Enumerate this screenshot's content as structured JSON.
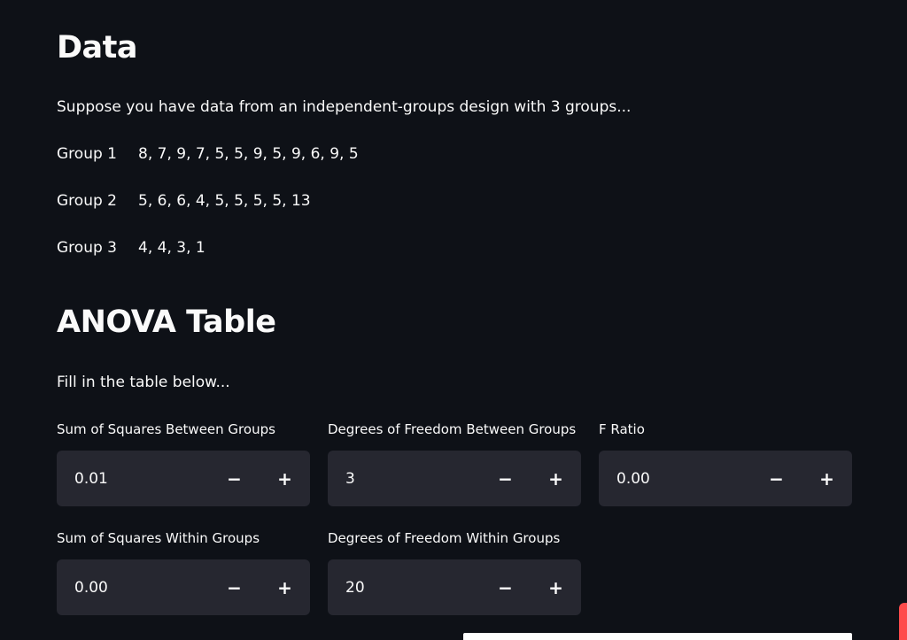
{
  "data_section": {
    "heading": "Data",
    "intro": "Suppose you have data from an independent-groups design with 3 groups...",
    "groups": [
      {
        "label": "Group 1",
        "values": "8, 7, 9, 7, 5, 5, 9, 5, 9, 6, 9, 5"
      },
      {
        "label": "Group 2",
        "values": "5, 6, 6, 4, 5, 5, 5, 5, 13"
      },
      {
        "label": "Group 3",
        "values": "4, 4, 3, 1"
      }
    ]
  },
  "anova_section": {
    "heading": "ANOVA Table",
    "instructions": "Fill in the table below...",
    "fields": {
      "ss_between": {
        "label": "Sum of Squares Between Groups",
        "value": "0.01"
      },
      "df_between": {
        "label": "Degrees of Freedom Between Groups",
        "value": "3"
      },
      "f_ratio": {
        "label": "F Ratio",
        "value": "0.00"
      },
      "ss_within": {
        "label": "Sum of Squares Within Groups",
        "value": "0.00"
      },
      "df_within": {
        "label": "Degrees of Freedom Within Groups",
        "value": "20"
      }
    },
    "decrement_symbol": "−",
    "increment_symbol": "+"
  },
  "colors": {
    "background": "#0e1117",
    "input_background": "#262730",
    "text": "#fafafa",
    "accent": "#ff4b4b"
  }
}
